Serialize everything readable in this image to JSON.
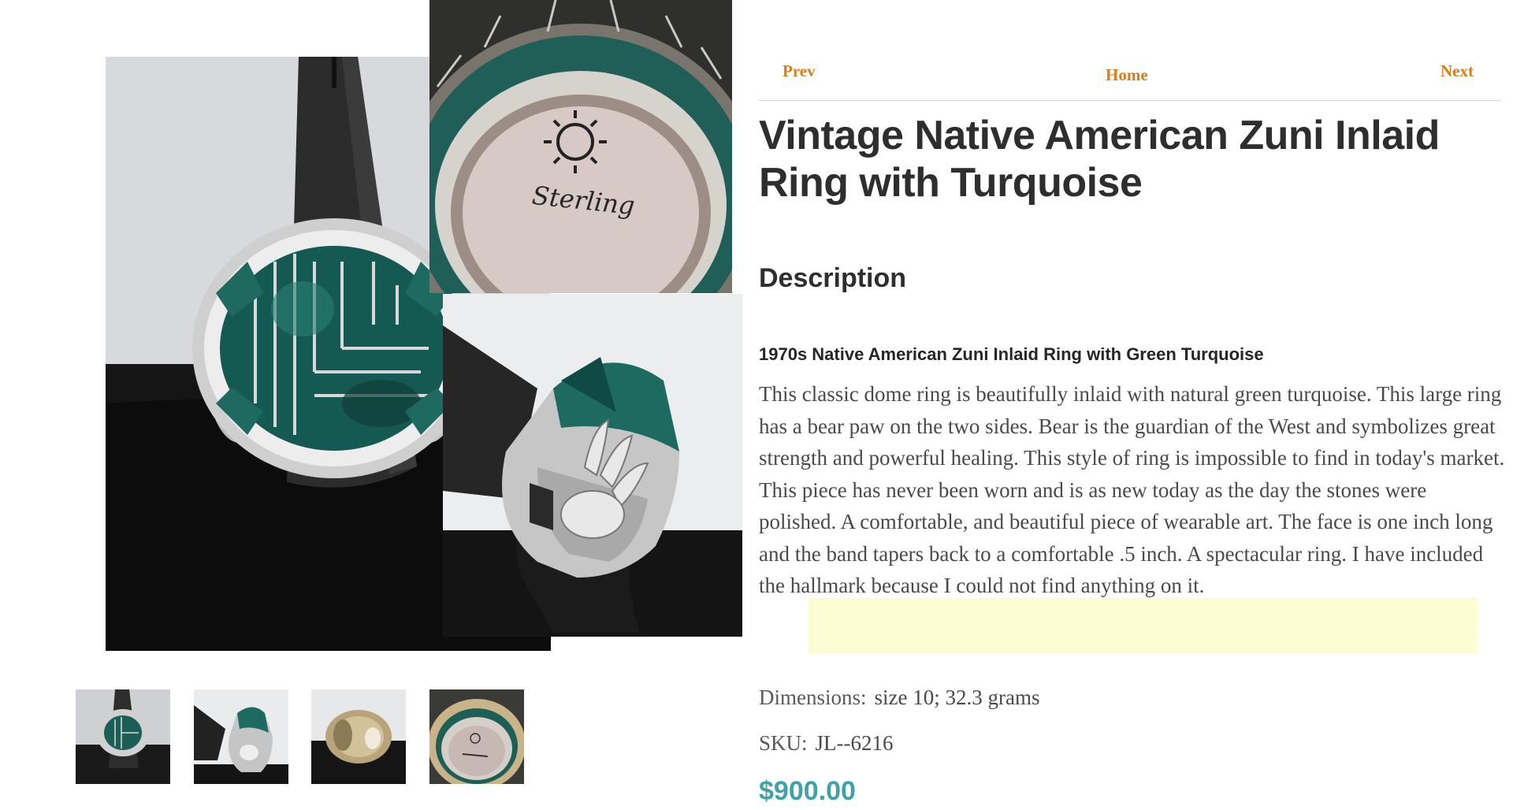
{
  "nav": {
    "prev": "Prev",
    "home": "Home",
    "next": "Next"
  },
  "product": {
    "title": "Vintage Native American Zuni Inlaid Ring with Turquoise",
    "section_heading": "Description",
    "subtitle": "1970s Native American Zuni Inlaid Ring with Green Turquoise",
    "description": "This classic dome ring is beautifully inlaid with natural green turquoise. This large ring has a bear paw on the two sides. Bear is the guardian of the West and symbolizes great strength and powerful healing. This style of ring is impossible to find in today's market. This piece has never been worn and is as new today as the day the stones were polished. A comfortable, and beautiful piece of wearable art. The face is one inch long and the band tapers back to a comfortable .5 inch. A spectacular ring. I have included the hallmark because I could not find anything on it.",
    "dimensions_label": "Dimensions:",
    "dimensions_value": "size 10; 32.3 grams",
    "sku_label": "SKU:",
    "sku_value": "JL--6216",
    "price": "$900.00"
  },
  "hallmark_text": "Sterling",
  "colors": {
    "nav_link": "#e07b18",
    "price": "#3fa2a8",
    "highlight": "#fdfdd3",
    "turquoise": "#1f6f66"
  },
  "icons": [
    "ring-front-image",
    "ring-side-image",
    "ring-hallmark-image",
    "ring-band-image"
  ]
}
